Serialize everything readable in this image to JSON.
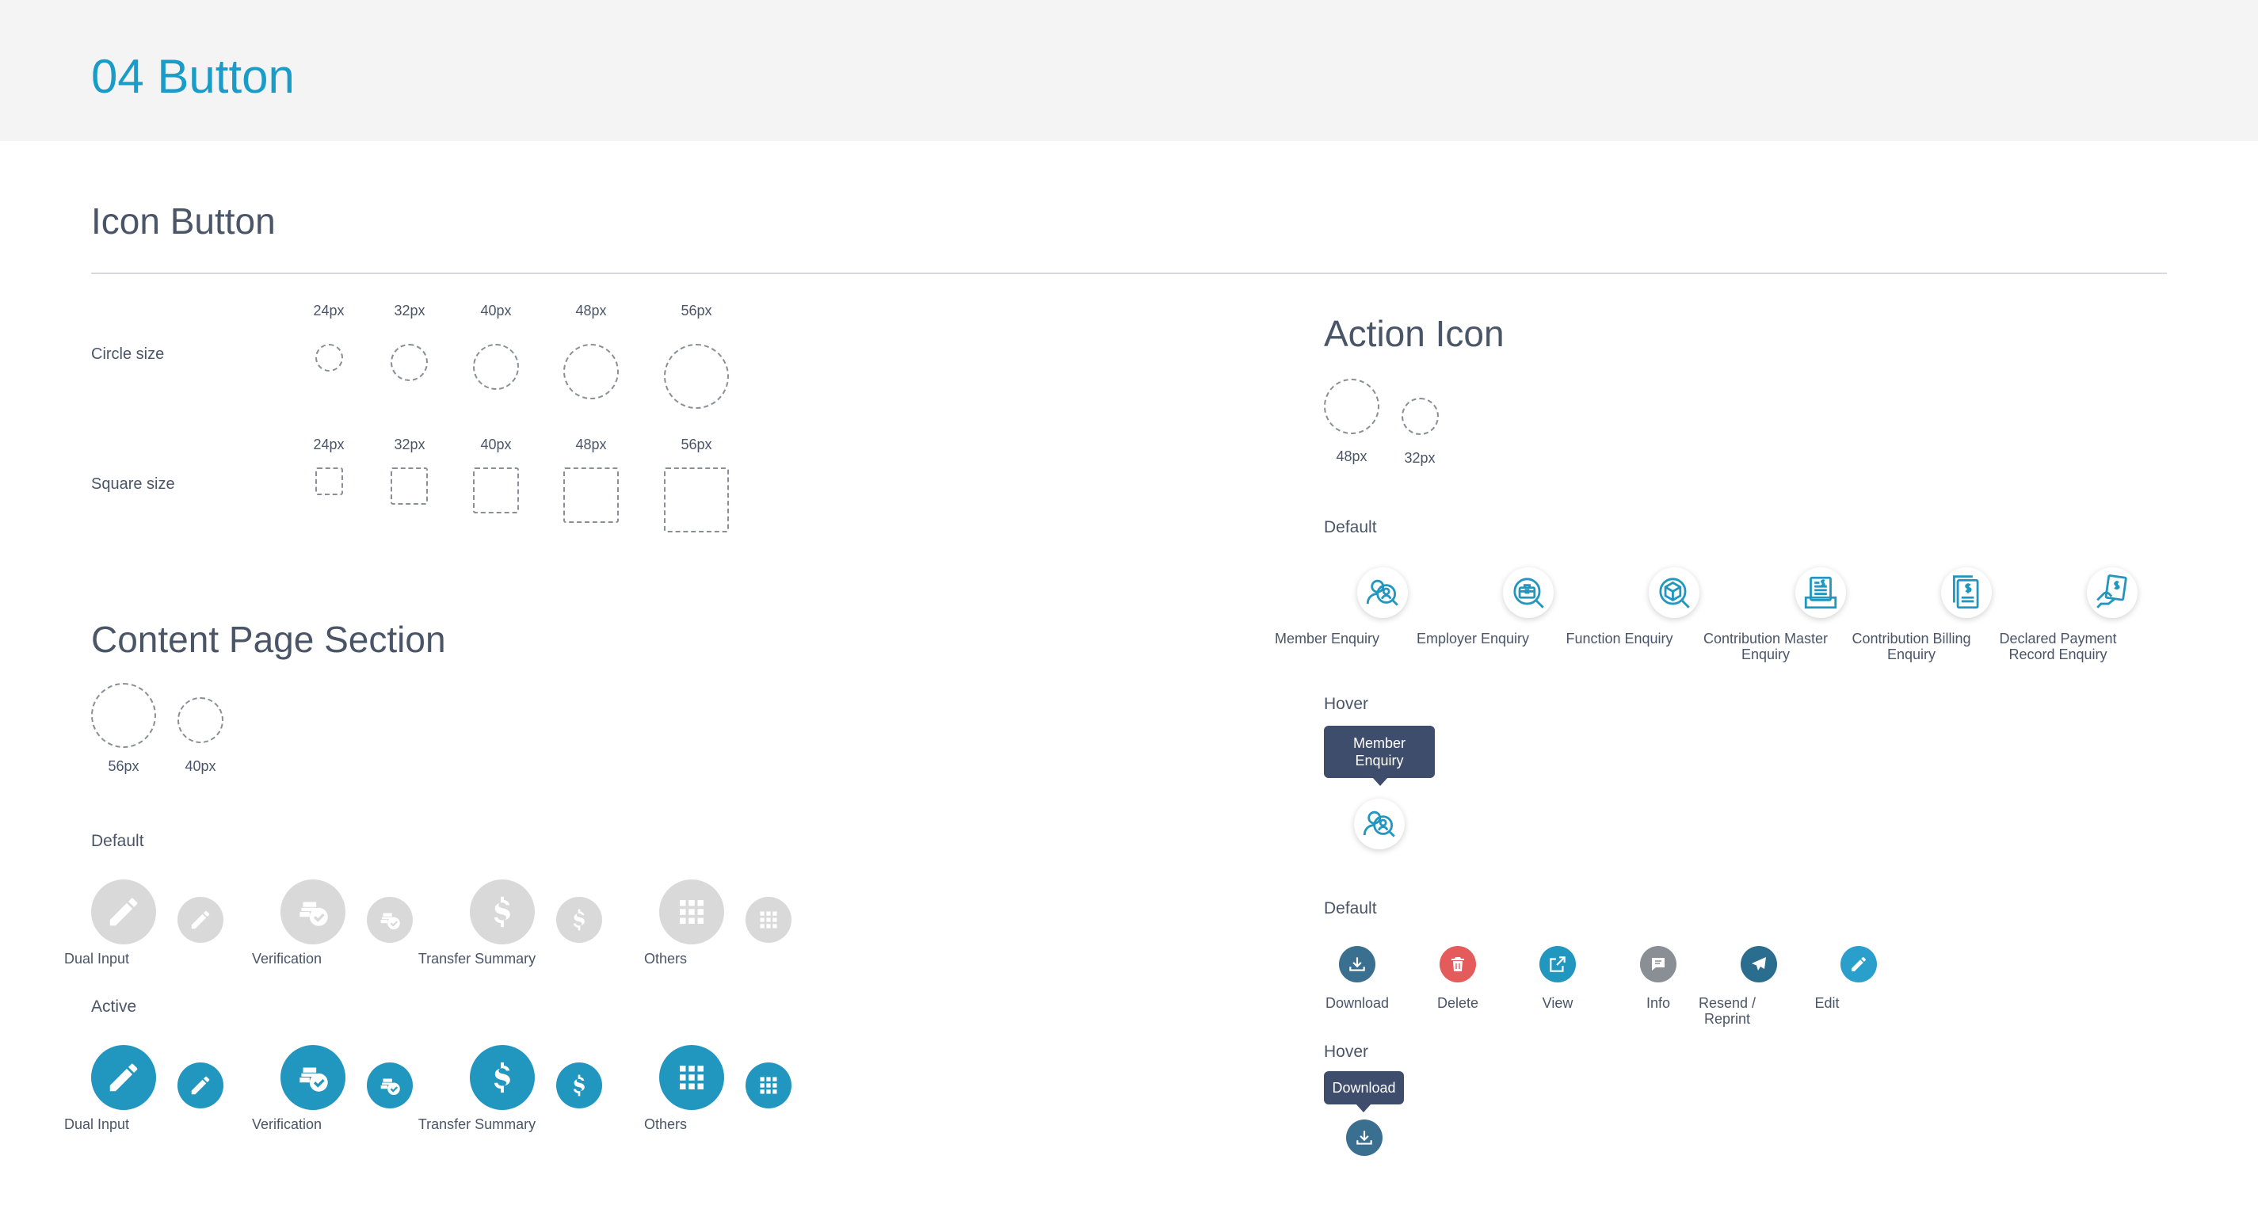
{
  "page_title": "04 Button",
  "icon_button": {
    "title": "Icon Button",
    "circle_label": "Circle size",
    "square_label": "Square size",
    "sizes": [
      "24px",
      "32px",
      "40px",
      "48px",
      "56px"
    ]
  },
  "content_page": {
    "title": "Content Page Section",
    "sizes": [
      "56px",
      "40px"
    ],
    "default_label": "Default",
    "active_label": "Active",
    "items": [
      "Dual Input",
      "Verification",
      "Transfer Summary",
      "Others"
    ]
  },
  "action_icon": {
    "title": "Action Icon",
    "sizes": [
      "48px",
      "32px"
    ],
    "default_label": "Default",
    "hover_label": "Hover",
    "enquiries": [
      {
        "line1": "Member Enquiry",
        "line2": ""
      },
      {
        "line1": "Employer Enquiry",
        "line2": ""
      },
      {
        "line1": "Function Enquiry",
        "line2": ""
      },
      {
        "line1": "Contribution Master",
        "line2": "Enquiry"
      },
      {
        "line1": "Contribution Billing",
        "line2": "Enquiry"
      },
      {
        "line1": "Declared Payment",
        "line2": "Record Enquiry"
      }
    ],
    "hover_tooltip": {
      "line1": "Member",
      "line2": "Enquiry"
    },
    "default2_label": "Default",
    "actions": [
      {
        "line1": "Download",
        "line2": "",
        "color": "#3a6f8f"
      },
      {
        "line1": "Delete",
        "line2": "",
        "color": "#e55a5a"
      },
      {
        "line1": "View",
        "line2": "",
        "color": "#2196bf"
      },
      {
        "line1": "Info",
        "line2": "",
        "color": "#8a8f96"
      },
      {
        "line1": "Resend /",
        "line2": "Reprint",
        "color": "#2a6d8e"
      },
      {
        "line1": "Edit",
        "line2": "",
        "color": "#2a9fcc"
      }
    ],
    "hover2_label": "Hover",
    "hover2_tooltip": "Download"
  },
  "colors": {
    "accent": "#1a9cc9",
    "active": "#2196bf",
    "inactive": "#d9d9d9",
    "tooltip": "#3d4d6b"
  }
}
